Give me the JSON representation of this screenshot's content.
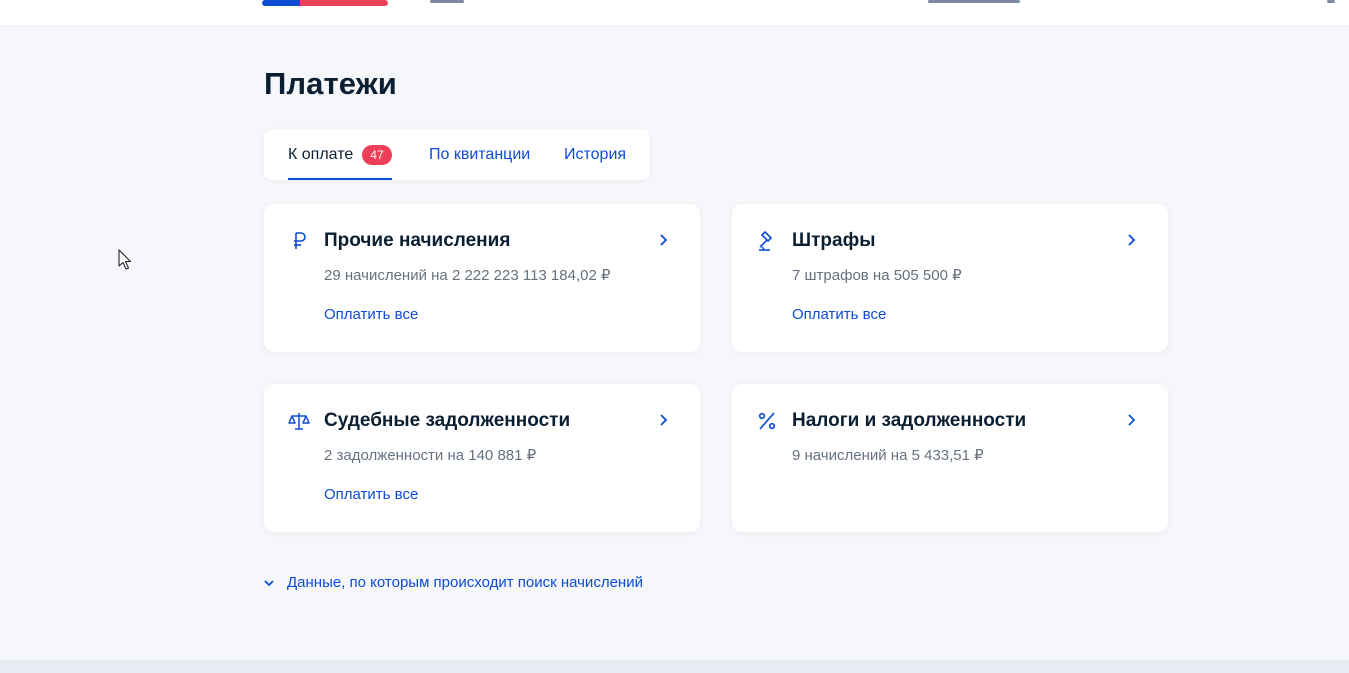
{
  "header": {
    "logo_icon": "gosuslugi-logo-fragment"
  },
  "page": {
    "title": "Платежи"
  },
  "tabs": [
    {
      "label": "К оплате",
      "badge": "47",
      "active": true
    },
    {
      "label": "По квитанции",
      "active": false
    },
    {
      "label": "История",
      "active": false
    }
  ],
  "cards": [
    {
      "icon": "ruble-icon",
      "title": "Прочие начисления",
      "subtitle": "29 начислений на 2 222 223 113 184,02 ₽",
      "action": "Оплатить все"
    },
    {
      "icon": "gavel-icon",
      "title": "Штрафы",
      "subtitle": "7 штрафов на 505 500 ₽",
      "action": "Оплатить все"
    },
    {
      "icon": "scales-icon",
      "title": "Судебные задолженности",
      "subtitle": "2 задолженности на 140 881 ₽",
      "action": "Оплатить все"
    },
    {
      "icon": "percent-icon",
      "title": "Налоги и задолженности",
      "subtitle": "9 начислений на 5 433,51 ₽"
    }
  ],
  "search_data": {
    "label": "Данные, по которым происходит поиск начислений",
    "icon": "chevron-down-icon"
  },
  "colors": {
    "accent": "#0d4cd3",
    "badge": "#ee3f58",
    "background": "#f5f7fb",
    "text": "#0b1f33",
    "muted": "#66727f"
  }
}
